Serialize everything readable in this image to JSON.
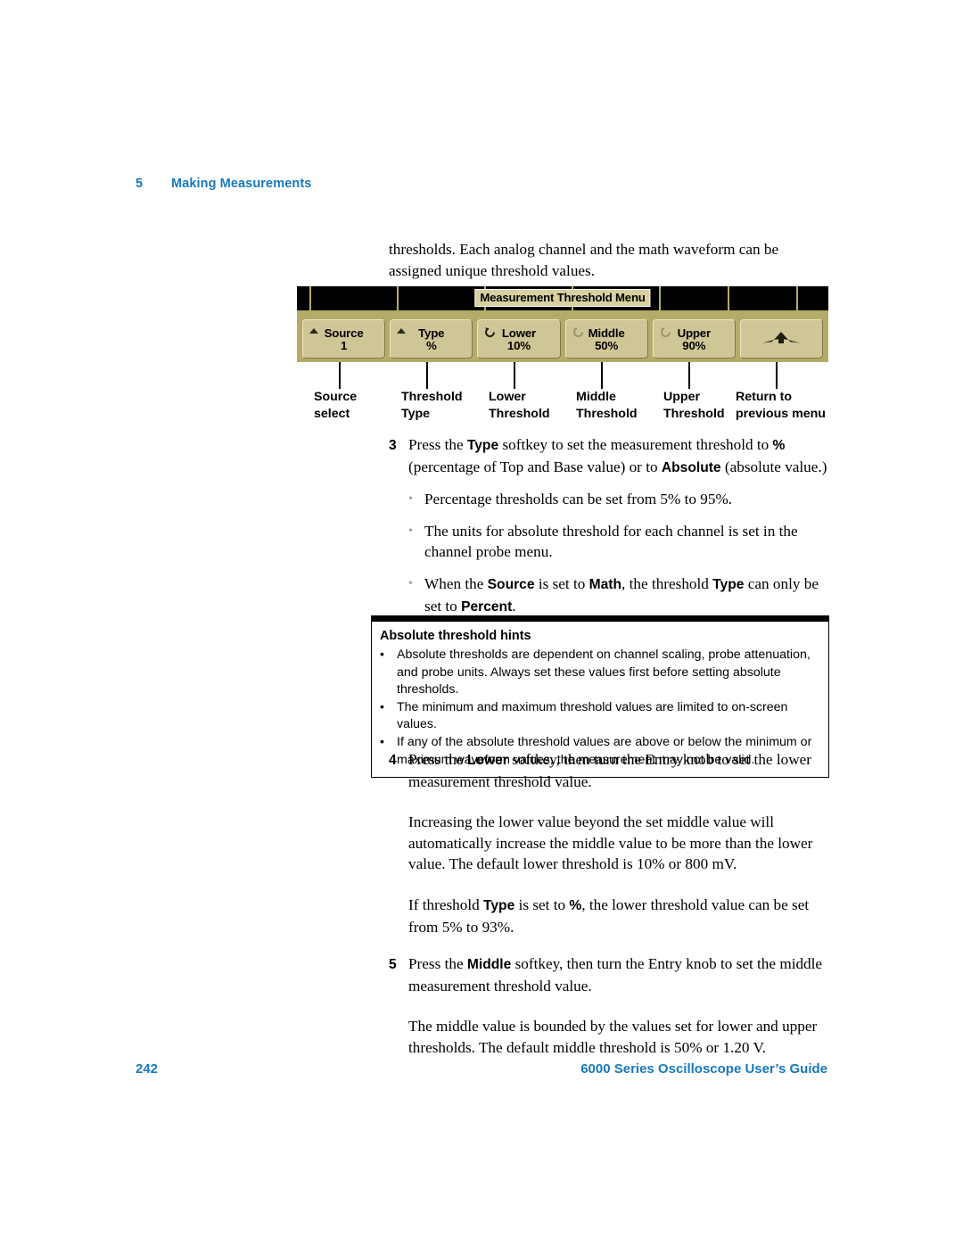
{
  "header": {
    "chapter_number": "5",
    "chapter_title": "Making Measurements"
  },
  "intro": {
    "paragraph": "thresholds. Each analog channel and the math waveform can be assigned unique threshold values."
  },
  "scope_figure": {
    "menu_title": "Measurement Threshold Menu",
    "softkeys": [
      {
        "icon": "triangle-up-icon",
        "line1": "Source",
        "line2": "1"
      },
      {
        "icon": "triangle-up-icon",
        "line1": "Type",
        "line2": "%"
      },
      {
        "icon": "rotary-knob-icon-active",
        "line1": "Lower",
        "line2": "10%"
      },
      {
        "icon": "rotary-knob-icon-dim",
        "line1": "Middle",
        "line2": "50%"
      },
      {
        "icon": "rotary-knob-icon-dim",
        "line1": "Upper",
        "line2": "90%"
      },
      {
        "icon": "return-arrow-icon",
        "line1": "",
        "line2": ""
      }
    ],
    "callout_labels": [
      {
        "line1": "Source",
        "line2": "select"
      },
      {
        "line1": "Threshold",
        "line2": "Type"
      },
      {
        "line1": "Lower",
        "line2": "Threshold"
      },
      {
        "line1": "Middle",
        "line2": "Threshold"
      },
      {
        "line1": "Upper",
        "line2": "Threshold"
      },
      {
        "line1": "Return to",
        "line2": "previous menu"
      }
    ]
  },
  "steps": {
    "step3": {
      "number": "3",
      "text_a": "Press the ",
      "bold_a": "Type",
      "text_b": " softkey to set the measurement threshold to ",
      "bold_b": "%",
      "text_c": " (percentage of Top and Base value) or to ",
      "bold_c": "Absolute",
      "text_d": " (absolute value.)",
      "bullets": [
        "Percentage thresholds can be set from 5% to 95%.",
        "The units for absolute threshold for each channel is set in the channel probe menu."
      ],
      "bullet3": {
        "text_a": "When the ",
        "bold_a": "Source",
        "text_b": " is set to ",
        "bold_b": "Math",
        "text_c": ", the threshold ",
        "bold_c": "Type",
        "text_d": " can only be set to ",
        "bold_d": "Percent",
        "text_e": "."
      }
    },
    "step4": {
      "number": "4",
      "text_a": "Press the ",
      "bold_a": "Lower",
      "text_b": " softkey, then turn the Entry knob to set the lower measurement threshold value.",
      "para2": "Increasing the lower value beyond the set middle value will automatically increase the middle value to be more than the lower value. The default lower threshold is 10% or 800 mV.",
      "para3": {
        "text_a": "If threshold ",
        "bold_a": "Type",
        "text_b": " is set to ",
        "bold_b": "%",
        "text_c": ", the lower threshold value can be set from 5% to 93%."
      }
    },
    "step5": {
      "number": "5",
      "text_a": "Press the ",
      "bold_a": "Middle",
      "text_b": " softkey, then turn the Entry knob to set the middle measurement threshold value.",
      "para2": "The middle value is bounded by the values set for lower and upper thresholds. The default middle threshold is 50% or 1.20 V."
    }
  },
  "callout": {
    "title": "Absolute threshold hints",
    "bullet_glyph": "•",
    "items": [
      "Absolute thresholds are dependent on channel scaling, probe attenuation, and probe units. Always set these values first before setting absolute thresholds.",
      "The minimum and maximum threshold values are limited to on-screen values.",
      "If any of the absolute threshold values are above or below the minimum or maximum waveform values, the measurement may not be valid."
    ]
  },
  "footer": {
    "page_number": "242",
    "guide_title": "6000 Series Oscilloscope User’s Guide"
  },
  "colors": {
    "accent_blue": "#1878be",
    "scope_bg": "#b5ab69",
    "softkey_bg": "#cfc697",
    "menu_title_bg": "#d8d0a0"
  }
}
